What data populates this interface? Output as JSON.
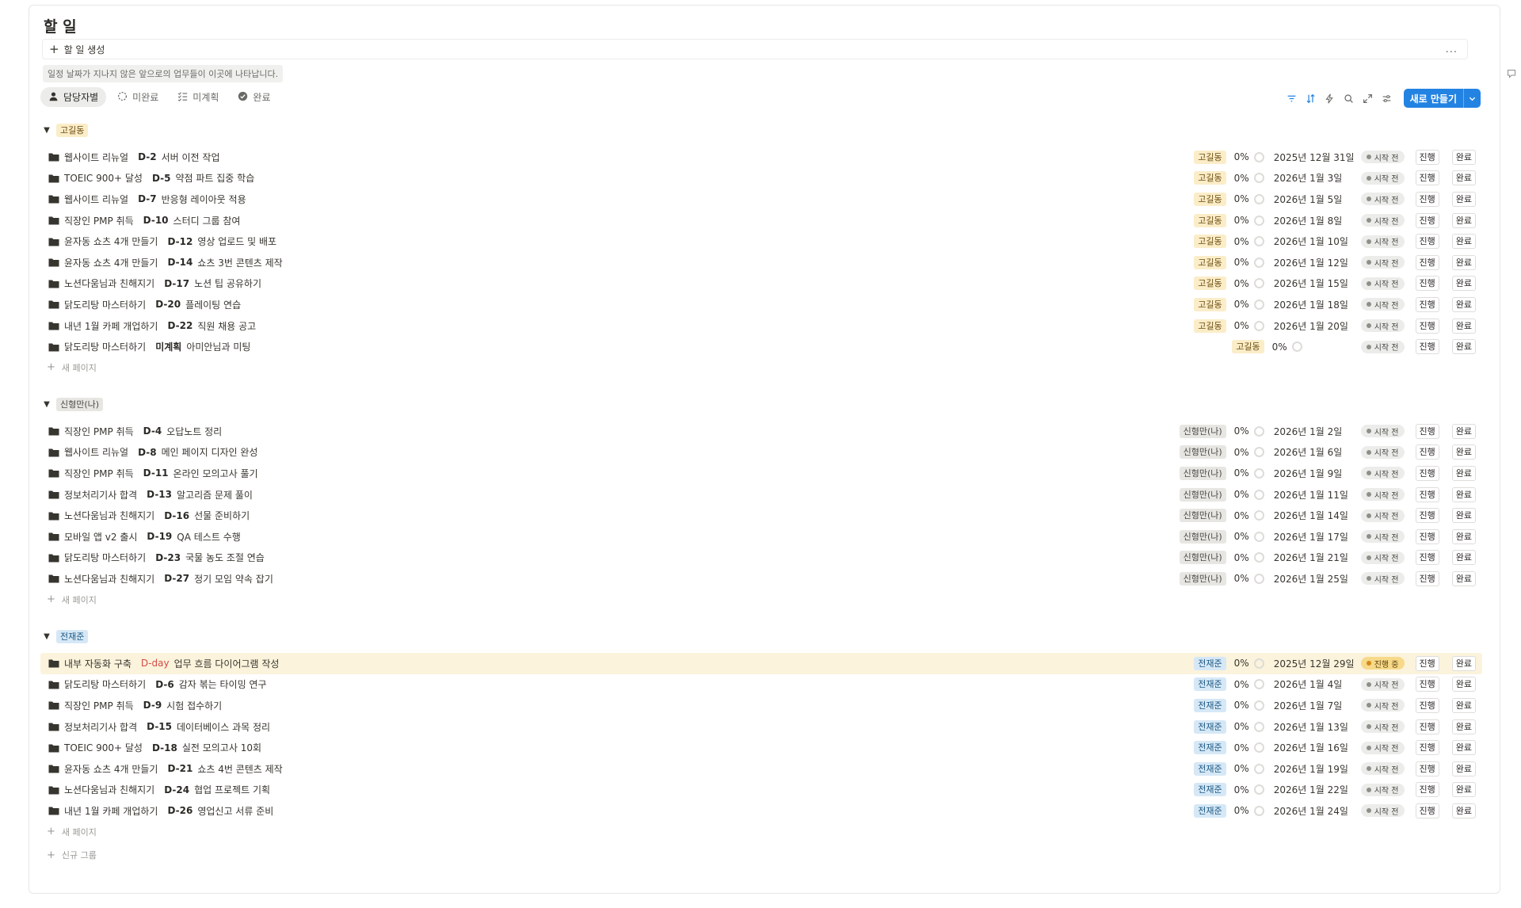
{
  "page": {
    "title": "할 일",
    "create_label": "할 일 생성",
    "more_label": "...",
    "hint": "일정 날짜가 지나지 않은 앞으로의 업무들이 이곳에 나타납니다."
  },
  "views": [
    {
      "label": "담당자별",
      "icon": "person-icon"
    },
    {
      "label": "미완료",
      "icon": "circle-dashed-icon"
    },
    {
      "label": "미계획",
      "icon": "checklist-icon"
    },
    {
      "label": "완료",
      "icon": "check-circle-icon"
    }
  ],
  "toolbar": {
    "icons": [
      "filter-icon",
      "sort-icon",
      "lightning-icon",
      "search-icon",
      "expand-icon",
      "settings-icon"
    ],
    "new_button": "새로 만들기"
  },
  "colors": {
    "accent": "#2383e2",
    "tag_yellow": "#fbedc8",
    "tag_gray": "#e7e6e3",
    "tag_blue": "#d6e8f6",
    "highlight_row": "#fbf3db",
    "in_progress": "#f7d98a"
  },
  "labels": {
    "start_button": "진행",
    "done_button": "완료",
    "new_page": "새 페이지",
    "new_group": "신규 그룹"
  },
  "groups": [
    {
      "name": "고길동",
      "color": "yellow",
      "rows": [
        {
          "project": "웹사이트 리뉴얼",
          "dday": "D-2",
          "task": "서버 이전 작업",
          "assignee": "고길동",
          "pct": "0%",
          "date": "2025년 12월 31일",
          "status": "시작 전"
        },
        {
          "project": "TOEIC 900+ 달성",
          "dday": "D-5",
          "task": "약점 파트 집중 학습",
          "assignee": "고길동",
          "pct": "0%",
          "date": "2026년 1월 3일",
          "status": "시작 전"
        },
        {
          "project": "웹사이트 리뉴얼",
          "dday": "D-7",
          "task": "반응형 레이아웃 적용",
          "assignee": "고길동",
          "pct": "0%",
          "date": "2026년 1월 5일",
          "status": "시작 전"
        },
        {
          "project": "직장인 PMP 취득",
          "dday": "D-10",
          "task": "스터디 그룹 참여",
          "assignee": "고길동",
          "pct": "0%",
          "date": "2026년 1월 8일",
          "status": "시작 전"
        },
        {
          "project": "윤자동 쇼츠 4개 만들기",
          "dday": "D-12",
          "task": "영상 업로드 및 배포",
          "assignee": "고길동",
          "pct": "0%",
          "date": "2026년 1월 10일",
          "status": "시작 전"
        },
        {
          "project": "윤자동 쇼츠 4개 만들기",
          "dday": "D-14",
          "task": "쇼츠 3번 콘텐츠 제작",
          "assignee": "고길동",
          "pct": "0%",
          "date": "2026년 1월 12일",
          "status": "시작 전"
        },
        {
          "project": "노션다움님과 친해지기",
          "dday": "D-17",
          "task": "노션 팁 공유하기",
          "assignee": "고길동",
          "pct": "0%",
          "date": "2026년 1월 15일",
          "status": "시작 전"
        },
        {
          "project": "닭도리탕 마스터하기",
          "dday": "D-20",
          "task": "플레이팅 연습",
          "assignee": "고길동",
          "pct": "0%",
          "date": "2026년 1월 18일",
          "status": "시작 전"
        },
        {
          "project": "내년 1월 카페 개업하기",
          "dday": "D-22",
          "task": "직원 채용 공고",
          "assignee": "고길동",
          "pct": "0%",
          "date": "2026년 1월 20일",
          "status": "시작 전"
        },
        {
          "project": "닭도리탕 마스터하기",
          "dday": "미계획",
          "task": "아미안님과 미팅",
          "assignee": "고길동",
          "pct": "0%",
          "date": "",
          "status": "시작 전"
        }
      ]
    },
    {
      "name": "신형만(나)",
      "color": "gray",
      "rows": [
        {
          "project": "직장인 PMP 취득",
          "dday": "D-4",
          "task": "오답노트 정리",
          "assignee": "신형만(나)",
          "pct": "0%",
          "date": "2026년 1월 2일",
          "status": "시작 전"
        },
        {
          "project": "웹사이트 리뉴얼",
          "dday": "D-8",
          "task": "메인 페이지 디자인 완성",
          "assignee": "신형만(나)",
          "pct": "0%",
          "date": "2026년 1월 6일",
          "status": "시작 전"
        },
        {
          "project": "직장인 PMP 취득",
          "dday": "D-11",
          "task": "온라인 모의고사 풀기",
          "assignee": "신형만(나)",
          "pct": "0%",
          "date": "2026년 1월 9일",
          "status": "시작 전"
        },
        {
          "project": "정보처리기사 합격",
          "dday": "D-13",
          "task": "알고리즘 문제 풀이",
          "assignee": "신형만(나)",
          "pct": "0%",
          "date": "2026년 1월 11일",
          "status": "시작 전"
        },
        {
          "project": "노션다움님과 친해지기",
          "dday": "D-16",
          "task": "선물 준비하기",
          "assignee": "신형만(나)",
          "pct": "0%",
          "date": "2026년 1월 14일",
          "status": "시작 전"
        },
        {
          "project": "모바일 앱 v2 출시",
          "dday": "D-19",
          "task": "QA 테스트 수행",
          "assignee": "신형만(나)",
          "pct": "0%",
          "date": "2026년 1월 17일",
          "status": "시작 전"
        },
        {
          "project": "닭도리탕 마스터하기",
          "dday": "D-23",
          "task": "국물 농도 조절 연습",
          "assignee": "신형만(나)",
          "pct": "0%",
          "date": "2026년 1월 21일",
          "status": "시작 전"
        },
        {
          "project": "노션다움님과 친해지기",
          "dday": "D-27",
          "task": "정기 모임 약속 잡기",
          "assignee": "신형만(나)",
          "pct": "0%",
          "date": "2026년 1월 25일",
          "status": "시작 전"
        }
      ]
    },
    {
      "name": "전재준",
      "color": "blue",
      "rows": [
        {
          "project": "내부 자동화 구축",
          "dday": "D-day",
          "task": "업무 흐름 다이어그램 작성",
          "assignee": "전재준",
          "pct": "0%",
          "date": "2025년 12월 29일",
          "status": "진행 중",
          "highlight": true
        },
        {
          "project": "닭도리탕 마스터하기",
          "dday": "D-6",
          "task": "감자 볶는 타이밍 연구",
          "assignee": "전재준",
          "pct": "0%",
          "date": "2026년 1월 4일",
          "status": "시작 전"
        },
        {
          "project": "직장인 PMP 취득",
          "dday": "D-9",
          "task": "시험 접수하기",
          "assignee": "전재준",
          "pct": "0%",
          "date": "2026년 1월 7일",
          "status": "시작 전"
        },
        {
          "project": "정보처리기사 합격",
          "dday": "D-15",
          "task": "데이터베이스 과목 정리",
          "assignee": "전재준",
          "pct": "0%",
          "date": "2026년 1월 13일",
          "status": "시작 전"
        },
        {
          "project": "TOEIC 900+ 달성",
          "dday": "D-18",
          "task": "실전 모의고사 10회",
          "assignee": "전재준",
          "pct": "0%",
          "date": "2026년 1월 16일",
          "status": "시작 전"
        },
        {
          "project": "윤자동 쇼츠 4개 만들기",
          "dday": "D-21",
          "task": "쇼츠 4번 콘텐츠 제작",
          "assignee": "전재준",
          "pct": "0%",
          "date": "2026년 1월 19일",
          "status": "시작 전"
        },
        {
          "project": "노션다움님과 친해지기",
          "dday": "D-24",
          "task": "협업 프로젝트 기획",
          "assignee": "전재준",
          "pct": "0%",
          "date": "2026년 1월 22일",
          "status": "시작 전"
        },
        {
          "project": "내년 1월 카페 개업하기",
          "dday": "D-26",
          "task": "영업신고 서류 준비",
          "assignee": "전재준",
          "pct": "0%",
          "date": "2026년 1월 24일",
          "status": "시작 전"
        }
      ]
    }
  ]
}
